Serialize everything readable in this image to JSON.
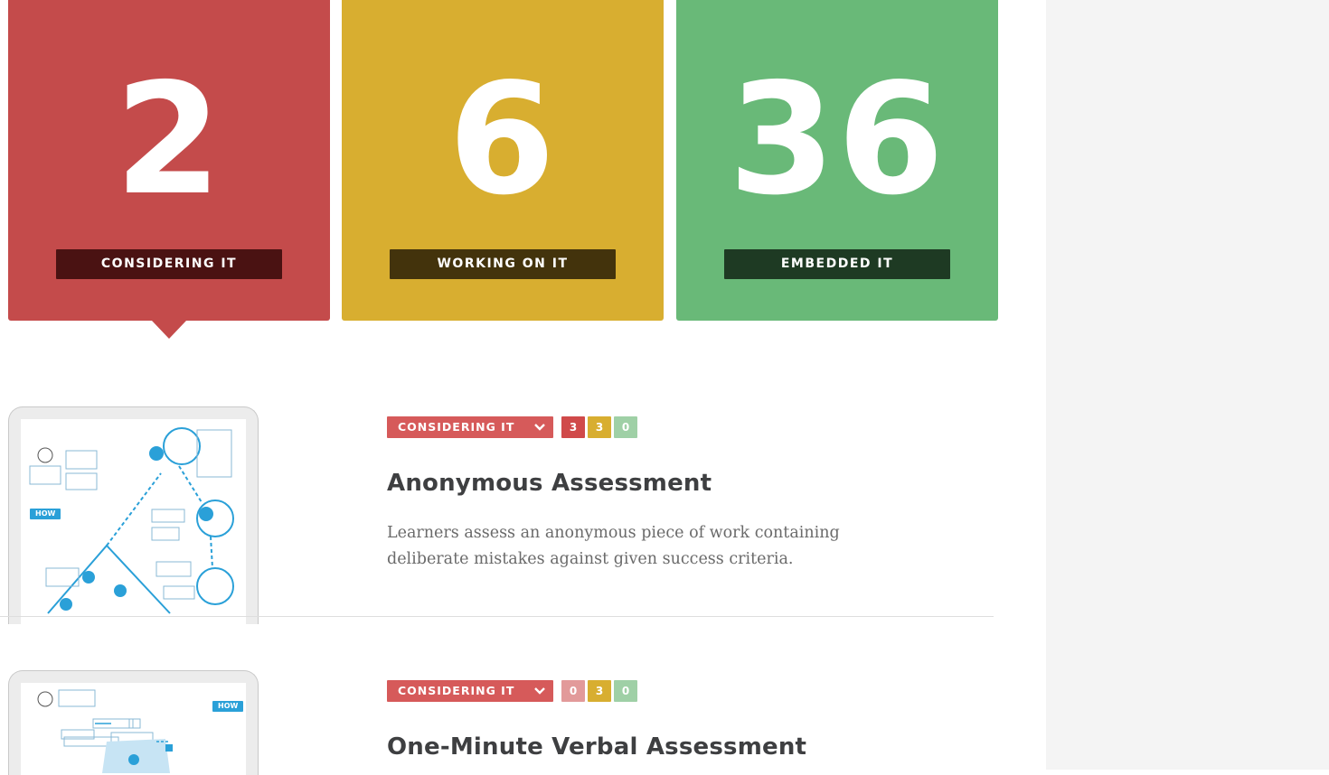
{
  "summary_tiles": [
    {
      "count": "2",
      "label": "CONSIDERING IT",
      "bg": "#c44b4b",
      "label_bg": "#4a1212"
    },
    {
      "count": "6",
      "label": "WORKING ON IT",
      "bg": "#d8ae30",
      "label_bg": "#43330c"
    },
    {
      "count": "36",
      "label": "EMBEDDED IT",
      "bg": "#69b978",
      "label_bg": "#1e3a23"
    }
  ],
  "strategies": [
    {
      "status": "CONSIDERING IT",
      "counts": [
        {
          "value": "3",
          "color": "#d04a4a"
        },
        {
          "value": "3",
          "color": "#d8ae30"
        },
        {
          "value": "0",
          "color": "#9fd0a6"
        }
      ],
      "title": "Anonymous Assessment",
      "description": "Learners assess an anonymous piece of work containing deliberate mistakes against given success criteria.",
      "thumb_tag": "HOW"
    },
    {
      "status": "CONSIDERING IT",
      "counts": [
        {
          "value": "0",
          "color": "#e29a9a"
        },
        {
          "value": "3",
          "color": "#d8ae30"
        },
        {
          "value": "0",
          "color": "#9fd0a6"
        }
      ],
      "title": "One-Minute Verbal Assessment",
      "description": "",
      "thumb_tag": "HOW"
    }
  ],
  "colors": {
    "considering": "#c44b4b",
    "working": "#d8ae30",
    "embedded": "#69b978",
    "dropdown": "#d65a5a",
    "diagram_blue": "#2aa0d8"
  },
  "icons": [
    "chevron-down-icon",
    "diagram-thumbnail"
  ]
}
